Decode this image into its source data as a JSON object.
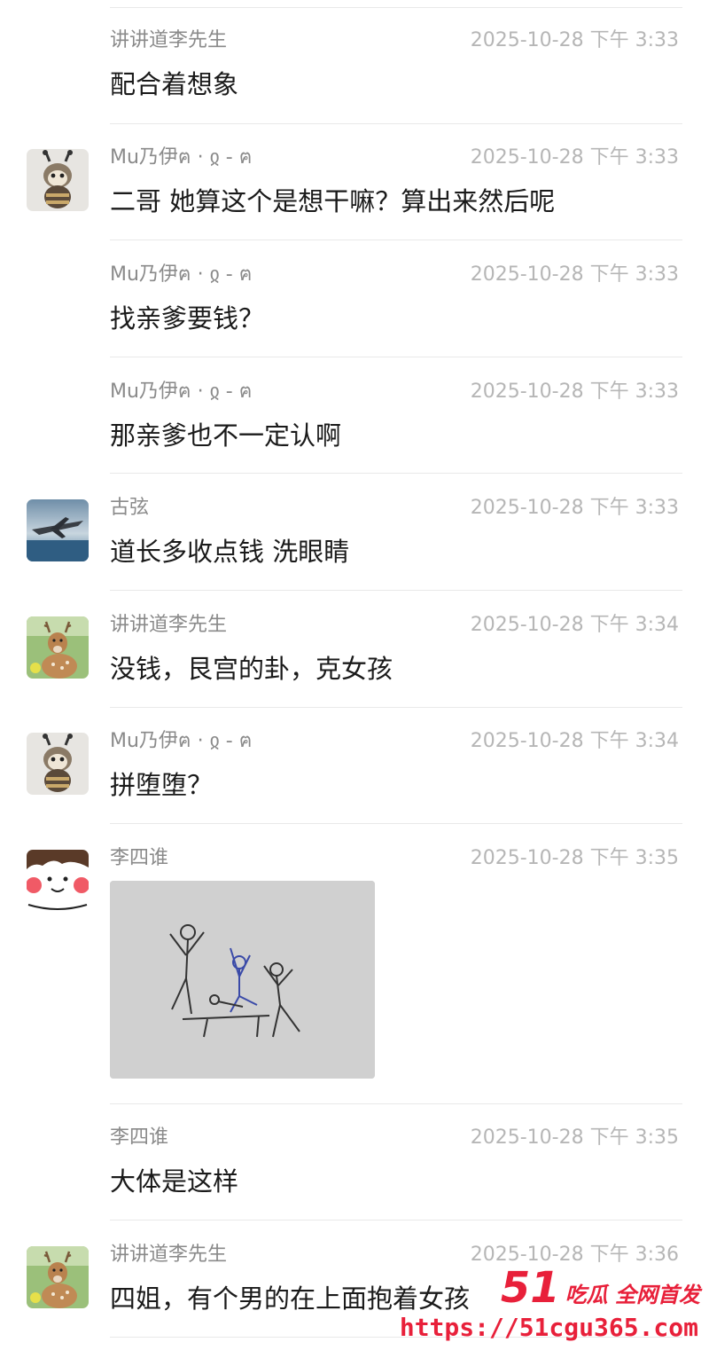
{
  "messages": [
    {
      "sender": "讲讲道李先生",
      "time": "2025-10-28 下午 3:33",
      "text": "配合着想象",
      "avatar": "deer"
    },
    {
      "sender": "Mu乃伊ฅ · ჲ - ฅ",
      "time": "2025-10-28 下午 3:33",
      "text": "二哥 她算这个是想干嘛？算出来然后呢",
      "avatar": "bee"
    },
    {
      "sender": "Mu乃伊ฅ · ჲ - ฅ",
      "time": "2025-10-28 下午 3:33",
      "text": "找亲爹要钱？",
      "avatar": "bee"
    },
    {
      "sender": "Mu乃伊ฅ · ჲ - ฅ",
      "time": "2025-10-28 下午 3:33",
      "text": "那亲爹也不一定认啊",
      "avatar": "bee"
    },
    {
      "sender": "古弦",
      "time": "2025-10-28 下午 3:33",
      "text": "道长多收点钱  洗眼睛",
      "avatar": "jet"
    },
    {
      "sender": "讲讲道李先生",
      "time": "2025-10-28 下午 3:34",
      "text": "没钱，艮宫的卦，克女孩",
      "avatar": "deer"
    },
    {
      "sender": "Mu乃伊ฅ · ჲ - ฅ",
      "time": "2025-10-28 下午 3:34",
      "text": "拼堕堕？",
      "avatar": "bee"
    },
    {
      "sender": "李四谁",
      "time": "2025-10-28 下午 3:35",
      "image": "stick-figure-drawing",
      "avatar": "cartoon"
    },
    {
      "sender": "李四谁",
      "time": "2025-10-28 下午 3:35",
      "text": "大体是这样",
      "avatar": "cartoon"
    },
    {
      "sender": "讲讲道李先生",
      "time": "2025-10-28 下午 3:36",
      "text": "四姐，有个男的在上面抱着女孩",
      "avatar": "deer"
    }
  ],
  "watermark": {
    "number": "51",
    "tagline": "吃瓜 全网首发",
    "url": "https://51cgu365.com"
  },
  "colors": {
    "sender": "#8a8a8a",
    "time": "#b6b6b6",
    "text": "#1a1a1a",
    "divider": "#e9e9e9",
    "watermark": "#e8203a"
  }
}
